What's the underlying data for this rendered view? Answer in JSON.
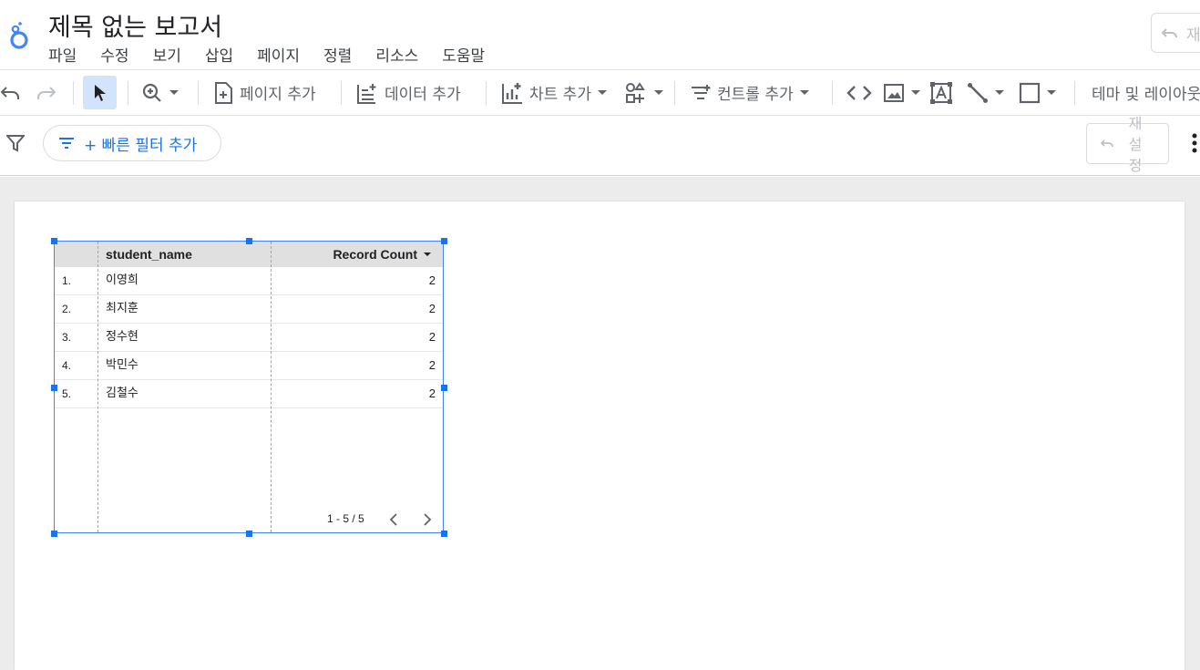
{
  "header": {
    "title": "제목 없는 보고서",
    "menu": [
      "파일",
      "수정",
      "보기",
      "삽입",
      "페이지",
      "정렬",
      "리소스",
      "도움말"
    ],
    "reset_top_label": "재"
  },
  "toolbar": {
    "add_page": "페이지 추가",
    "add_data": "데이터 추가",
    "add_chart": "차트 추가",
    "add_control": "컨트롤 추가",
    "theme_layout": "테마 및 레이아웃"
  },
  "filterbar": {
    "quick_filter": "+ 빠른 필터 추가",
    "reset": "재설정"
  },
  "table": {
    "columns": [
      "student_name",
      "Record Count"
    ],
    "sort_column": "Record Count",
    "rows": [
      {
        "idx": "1.",
        "name": "이영희",
        "count": "2"
      },
      {
        "idx": "2.",
        "name": "최지훈",
        "count": "2"
      },
      {
        "idx": "3.",
        "name": "정수현",
        "count": "2"
      },
      {
        "idx": "4.",
        "name": "박민수",
        "count": "2"
      },
      {
        "idx": "5.",
        "name": "김철수",
        "count": "2"
      }
    ],
    "pagination": "1 - 5 / 5"
  },
  "colors": {
    "accent": "#1a73e8",
    "selection": "#4285f4",
    "header_bg": "#e0e0e0"
  },
  "icons": [
    "looker-studio-logo-icon",
    "undo-icon",
    "redo-icon",
    "cursor-icon",
    "zoom-icon",
    "add-page-icon",
    "add-data-icon",
    "add-chart-icon",
    "add-shape-icon",
    "add-control-icon",
    "code-icon",
    "image-icon",
    "text-icon",
    "line-icon",
    "rectangle-icon",
    "filter-icon",
    "more-vert-icon",
    "chevron-left-icon",
    "chevron-right-icon"
  ]
}
